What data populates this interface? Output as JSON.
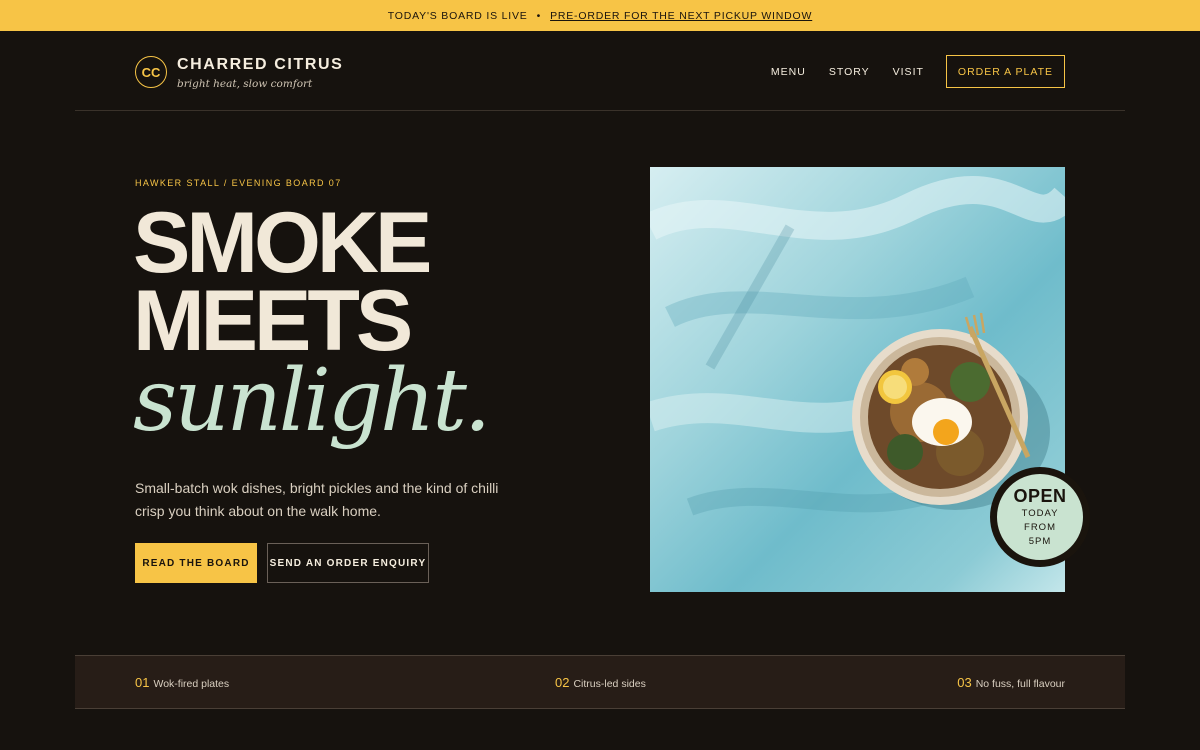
{
  "announcement": {
    "status": "TODAY'S BOARD IS LIVE",
    "separator": "•",
    "link": "PRE-ORDER FOR THE NEXT PICKUP WINDOW"
  },
  "brand": {
    "monogram": "CC",
    "name": "CHARRED CITRUS",
    "tagline": "bright heat, slow comfort"
  },
  "nav": {
    "items": [
      "MENU",
      "STORY",
      "VISIT"
    ],
    "cta": "ORDER A PLATE"
  },
  "hero": {
    "eyebrow": "HAWKER STALL / EVENING BOARD 07",
    "headline_line1": "SMOKE",
    "headline_line2": "MEETS",
    "headline_script": "sunlight.",
    "subcopy": "Small-batch wok dishes, bright pickles and the kind of chilli crisp you think about on the walk home.",
    "primary_button": "READ THE BOARD",
    "secondary_button": "SEND AN ORDER ENQUIRY"
  },
  "badge": {
    "title": "OPEN",
    "line1": "TODAY",
    "line2": "FROM",
    "line3": "5PM"
  },
  "features": [
    {
      "num": "01",
      "label": "Wok-fired plates"
    },
    {
      "num": "02",
      "label": "Citrus-led sides"
    },
    {
      "num": "03",
      "label": "No fuss, full flavour"
    }
  ],
  "colors": {
    "accent": "#f7c446",
    "background": "#16120e",
    "mint": "#c9e3d0",
    "cream": "#f1e8d8"
  }
}
